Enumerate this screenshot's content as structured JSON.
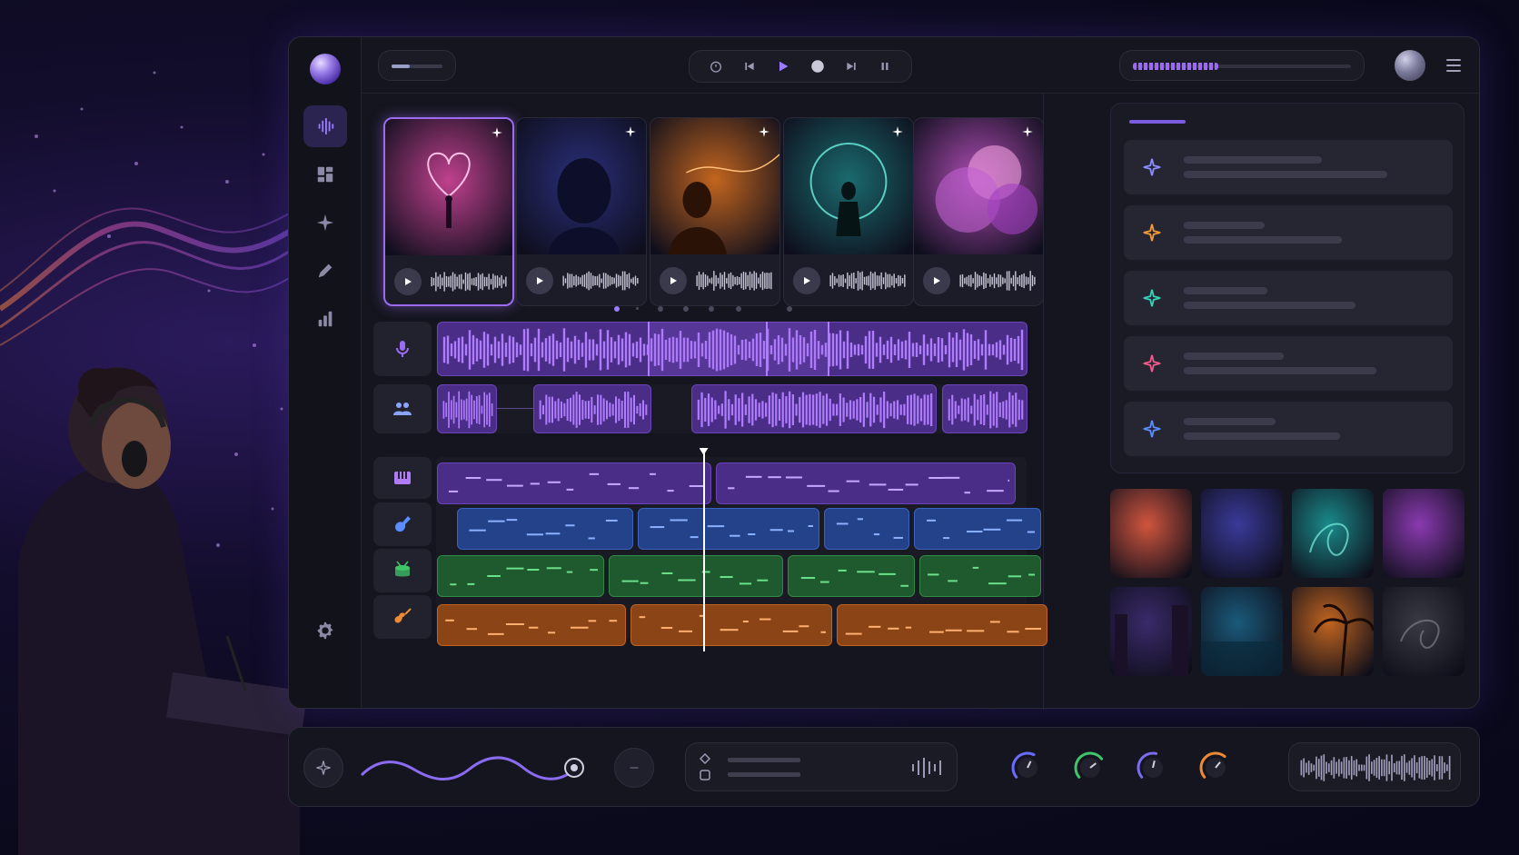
{
  "app": {
    "accent": "#9b6cf2",
    "background": "#0b0a1c"
  },
  "sidebar": {
    "items": [
      {
        "icon": "waveform-icon",
        "active": true
      },
      {
        "icon": "dashboard-icon",
        "active": false
      },
      {
        "icon": "sparkle-icon",
        "active": false
      },
      {
        "icon": "pencil-icon",
        "active": false
      },
      {
        "icon": "bar-chart-icon",
        "active": false
      }
    ],
    "footer_icon": "gear-icon"
  },
  "topbar": {
    "transport": [
      "timer-icon",
      "skip-back-icon",
      "play-icon",
      "record-icon",
      "skip-forward-icon",
      "pause-icon"
    ],
    "progress": 0.42
  },
  "track_cards": [
    {
      "theme": "heart",
      "color": "#c0418e",
      "selected": true
    },
    {
      "theme": "silhouette-night",
      "color": "#2a2f7a",
      "selected": false
    },
    {
      "theme": "sunset-figure",
      "color": "#c2651e",
      "selected": false
    },
    {
      "theme": "teal-portal",
      "color": "#1a6a6e",
      "selected": false
    },
    {
      "theme": "pink-clouds",
      "color": "#b04db5",
      "selected": false
    }
  ],
  "pager": {
    "count": 8,
    "active": 0
  },
  "lanes": [
    {
      "icon": "microphone-icon",
      "color": "#9b6cf2"
    },
    {
      "icon": "people-icon",
      "color": "#8aa4ff"
    },
    {
      "icon": "piano-icon",
      "color": "#b07cf5"
    },
    {
      "icon": "guitar-pick-icon",
      "color": "#5a8dff"
    },
    {
      "icon": "drum-icon",
      "color": "#3fc46a"
    },
    {
      "icon": "guitar-icon",
      "color": "#ef8a34"
    }
  ],
  "playhead": 0.45,
  "right_panel": {
    "rows": [
      {
        "icon": "sparkle-icon",
        "color": "#8a8cff"
      },
      {
        "icon": "sparkle-icon",
        "color": "#f29a3a"
      },
      {
        "icon": "sparkle-icon",
        "color": "#36d1b8"
      },
      {
        "icon": "sparkle-icon",
        "color": "#f25a8a"
      },
      {
        "icon": "sparkle-icon",
        "color": "#5a8dff"
      }
    ]
  },
  "thumbnails": [
    {
      "theme": "sunset-clouds",
      "color": "#d0553e"
    },
    {
      "theme": "night-tree",
      "color": "#3a3a9a"
    },
    {
      "theme": "teal-swirl",
      "color": "#1a8a8a"
    },
    {
      "theme": "purple-nebula",
      "color": "#8a3ab0"
    },
    {
      "theme": "city-night",
      "color": "#3a2a6a"
    },
    {
      "theme": "ocean-night",
      "color": "#1a5a7a"
    },
    {
      "theme": "palm-sunset",
      "color": "#c0641f"
    },
    {
      "theme": "dark-swirl",
      "color": "#3a3a44"
    }
  ],
  "bottom_bar": {
    "knobs": [
      {
        "color": "#6a6cff",
        "level": 0.6
      },
      {
        "color": "#3fc46a",
        "level": 0.7
      },
      {
        "color": "#7a6cf2",
        "level": 0.55
      },
      {
        "color": "#ef8a34",
        "level": 0.65
      }
    ],
    "slider_level": 1.0
  }
}
